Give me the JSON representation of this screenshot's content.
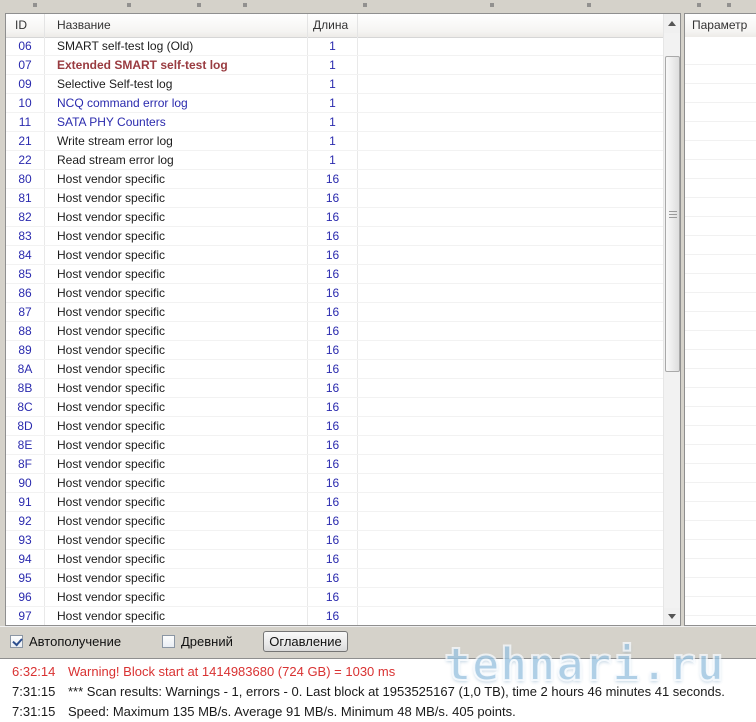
{
  "table": {
    "columns": [
      {
        "label": "ID"
      },
      {
        "label": "Название"
      },
      {
        "label": "Длина"
      }
    ],
    "rows": [
      {
        "id": "06",
        "name": "SMART self-test log (Old)",
        "length": "1",
        "style": "default"
      },
      {
        "id": "07",
        "name": "Extended SMART self-test log",
        "length": "1",
        "style": "alert"
      },
      {
        "id": "09",
        "name": "Selective Self-test log",
        "length": "1",
        "style": "default"
      },
      {
        "id": "10",
        "name": "NCQ command error log",
        "length": "1",
        "style": "link"
      },
      {
        "id": "11",
        "name": "SATA PHY Counters",
        "length": "1",
        "style": "link"
      },
      {
        "id": "21",
        "name": "Write stream error log",
        "length": "1",
        "style": "default"
      },
      {
        "id": "22",
        "name": "Read stream error log",
        "length": "1",
        "style": "default"
      },
      {
        "id": "80",
        "name": "Host vendor specific",
        "length": "16",
        "style": "default"
      },
      {
        "id": "81",
        "name": "Host vendor specific",
        "length": "16",
        "style": "default"
      },
      {
        "id": "82",
        "name": "Host vendor specific",
        "length": "16",
        "style": "default"
      },
      {
        "id": "83",
        "name": "Host vendor specific",
        "length": "16",
        "style": "default"
      },
      {
        "id": "84",
        "name": "Host vendor specific",
        "length": "16",
        "style": "default"
      },
      {
        "id": "85",
        "name": "Host vendor specific",
        "length": "16",
        "style": "default"
      },
      {
        "id": "86",
        "name": "Host vendor specific",
        "length": "16",
        "style": "default"
      },
      {
        "id": "87",
        "name": "Host vendor specific",
        "length": "16",
        "style": "default"
      },
      {
        "id": "88",
        "name": "Host vendor specific",
        "length": "16",
        "style": "default"
      },
      {
        "id": "89",
        "name": "Host vendor specific",
        "length": "16",
        "style": "default"
      },
      {
        "id": "8A",
        "name": "Host vendor specific",
        "length": "16",
        "style": "default"
      },
      {
        "id": "8B",
        "name": "Host vendor specific",
        "length": "16",
        "style": "default"
      },
      {
        "id": "8C",
        "name": "Host vendor specific",
        "length": "16",
        "style": "default"
      },
      {
        "id": "8D",
        "name": "Host vendor specific",
        "length": "16",
        "style": "default"
      },
      {
        "id": "8E",
        "name": "Host vendor specific",
        "length": "16",
        "style": "default"
      },
      {
        "id": "8F",
        "name": "Host vendor specific",
        "length": "16",
        "style": "default"
      },
      {
        "id": "90",
        "name": "Host vendor specific",
        "length": "16",
        "style": "default"
      },
      {
        "id": "91",
        "name": "Host vendor specific",
        "length": "16",
        "style": "default"
      },
      {
        "id": "92",
        "name": "Host vendor specific",
        "length": "16",
        "style": "default"
      },
      {
        "id": "93",
        "name": "Host vendor specific",
        "length": "16",
        "style": "default"
      },
      {
        "id": "94",
        "name": "Host vendor specific",
        "length": "16",
        "style": "default"
      },
      {
        "id": "95",
        "name": "Host vendor specific",
        "length": "16",
        "style": "default"
      },
      {
        "id": "96",
        "name": "Host vendor specific",
        "length": "16",
        "style": "default"
      },
      {
        "id": "97",
        "name": "Host vendor specific",
        "length": "16",
        "style": "default"
      }
    ]
  },
  "right_panel": {
    "header": "Параметр"
  },
  "controls": {
    "auto_label": "Автополучение",
    "auto_checked": true,
    "ancient_label": "Древний",
    "ancient_checked": false,
    "toc_button": "Оглавление"
  },
  "log": {
    "entries": [
      {
        "time": "6:32:14",
        "message": "Warning! Block start at 1414983680 (724 GB)  = 1030 ms",
        "level": "warning"
      },
      {
        "time": "7:31:15",
        "message": "*** Scan results: Warnings - 1, errors - 0. Last block at 1953525167 (1,0 TB), time 2 hours 46 minutes 41 seconds.",
        "level": "info"
      },
      {
        "time": "7:31:15",
        "message": "Speed: Maximum 135 MB/s. Average 91 MB/s. Minimum 48 MB/s. 405 points.",
        "level": "info"
      }
    ]
  },
  "watermark": {
    "text": "tehnari.ru"
  },
  "colors": {
    "id_text": "#2a2aae",
    "link_text": "#2a2aae",
    "alert_text": "#993b40",
    "warning_text": "#d93232",
    "watermark_blue": "#9cc4e0",
    "panel_gray": "#d5d2ca"
  }
}
